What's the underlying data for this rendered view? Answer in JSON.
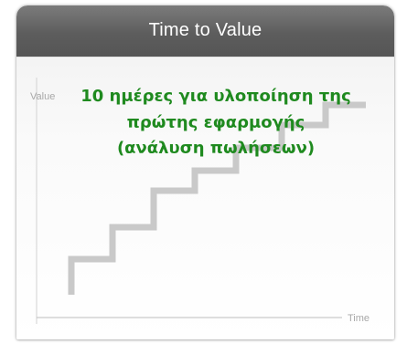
{
  "header": {
    "title": "Time to Value"
  },
  "axes": {
    "y_label": "Value",
    "x_label": "Time"
  },
  "overlay": {
    "lines": [
      "10 ημέρες για υλοποίηση της",
      "πρώτης εφαρμογής",
      "(ανάλυση πωλήσεων)"
    ]
  },
  "colors": {
    "header": "#5d5d5d",
    "overlay_text": "#1f8a1f",
    "staircase": "#c9c9c9",
    "axis": "#b5b5b5"
  },
  "icons": [
    "staircase-step-line"
  ]
}
